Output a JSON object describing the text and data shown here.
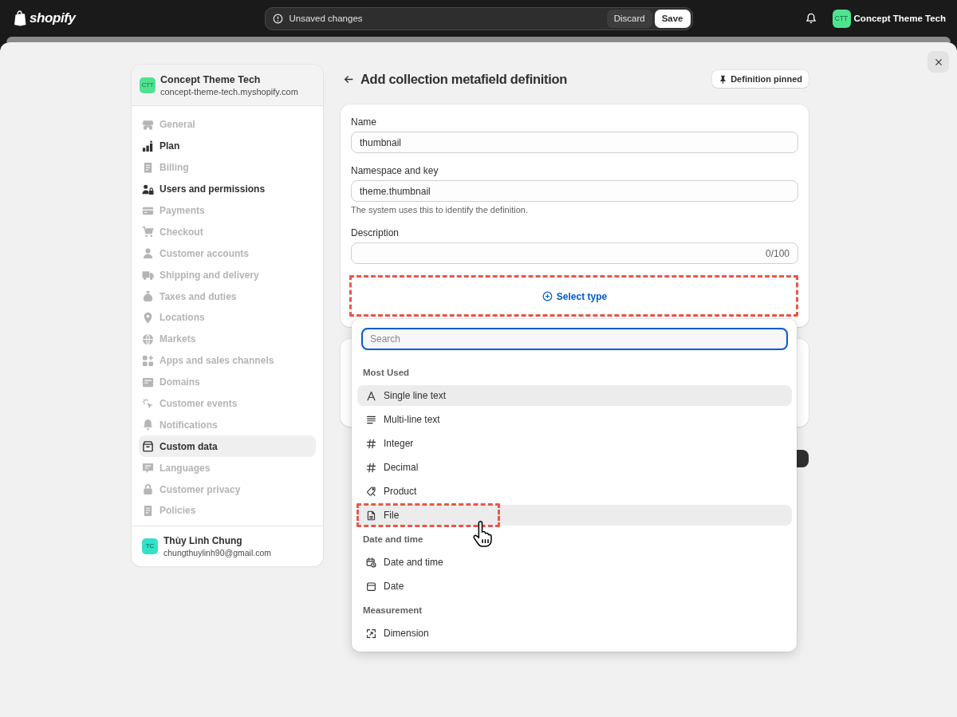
{
  "top_bar": {
    "logo": "shopify",
    "unsaved_changes": {
      "message": "Unsaved changes",
      "buttons": [
        {
          "label": "Discard",
          "kind": "secondary"
        },
        {
          "label": "Save",
          "kind": "primary"
        }
      ]
    },
    "store": {
      "initials": "CTT",
      "name": "Concept Theme Tech"
    }
  },
  "sidebar": {
    "store": {
      "initials": "CTT",
      "name": "Concept Theme Tech",
      "domain": "concept-theme-tech.myshopify.com"
    },
    "items": [
      {
        "label": "General",
        "selected": false,
        "disabled": true
      },
      {
        "label": "Plan",
        "selected": false,
        "disabled": false
      },
      {
        "label": "Billing",
        "selected": false,
        "disabled": true
      },
      {
        "label": "Users and permissions",
        "selected": false,
        "disabled": false
      },
      {
        "label": "Payments",
        "selected": false,
        "disabled": true
      },
      {
        "label": "Checkout",
        "selected": false,
        "disabled": true
      },
      {
        "label": "Customer accounts",
        "selected": false,
        "disabled": true
      },
      {
        "label": "Shipping and delivery",
        "selected": false,
        "disabled": true
      },
      {
        "label": "Taxes and duties",
        "selected": false,
        "disabled": true
      },
      {
        "label": "Locations",
        "selected": false,
        "disabled": true
      },
      {
        "label": "Markets",
        "selected": false,
        "disabled": true
      },
      {
        "label": "Apps and sales channels",
        "selected": false,
        "disabled": true
      },
      {
        "label": "Domains",
        "selected": false,
        "disabled": true
      },
      {
        "label": "Customer events",
        "selected": false,
        "disabled": true
      },
      {
        "label": "Notifications",
        "selected": false,
        "disabled": true
      },
      {
        "label": "Custom data",
        "selected": true,
        "disabled": false
      },
      {
        "label": "Languages",
        "selected": false,
        "disabled": true
      },
      {
        "label": "Customer privacy",
        "selected": false,
        "disabled": true
      },
      {
        "label": "Policies",
        "selected": false,
        "disabled": true
      }
    ],
    "user": {
      "initials": "TC",
      "name": "Thùy Linh Chung",
      "email": "chungthuylinh90@gmail.com"
    }
  },
  "page": {
    "title": "Add collection metafield definition",
    "pin_button": "Definition pinned",
    "fields": [
      {
        "label": "Name",
        "value": "thumbnail"
      },
      {
        "label": "Namespace and key",
        "value": "theme.thumbnail",
        "help": "The system uses this to identify the definition."
      },
      {
        "label": "Description",
        "counter": "0/100"
      }
    ],
    "select_type": {
      "label": "Select type",
      "annotated": true
    }
  },
  "type_menu": {
    "search": {
      "placeholder": "Search",
      "focused": true
    },
    "groups": [
      {
        "title": "Most Used",
        "items": [
          {
            "label": "Single line text",
            "highlighted": true,
            "hovered": false,
            "annotated": false
          },
          {
            "label": "Multi-line text",
            "highlighted": false,
            "hovered": false,
            "annotated": false
          },
          {
            "label": "Integer",
            "highlighted": false,
            "hovered": false,
            "annotated": false
          },
          {
            "label": "Decimal",
            "highlighted": false,
            "hovered": false,
            "annotated": false
          },
          {
            "label": "Product",
            "highlighted": false,
            "hovered": false,
            "annotated": false
          },
          {
            "label": "File",
            "highlighted": true,
            "hovered": true,
            "annotated": true
          }
        ]
      },
      {
        "title": "Date and time",
        "items": [
          {
            "label": "Date and time",
            "highlighted": false,
            "hovered": false,
            "annotated": false
          },
          {
            "label": "Date",
            "highlighted": false,
            "hovered": false,
            "annotated": false
          }
        ]
      },
      {
        "title": "Measurement",
        "items": [
          {
            "label": "Dimension",
            "highlighted": false,
            "hovered": false,
            "annotated": false
          }
        ]
      }
    ]
  }
}
